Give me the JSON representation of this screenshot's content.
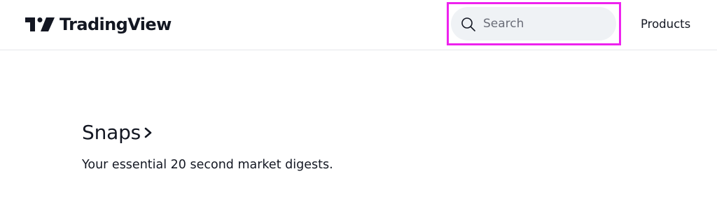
{
  "header": {
    "logo_text": "TradingView",
    "search": {
      "placeholder": "Search",
      "value": ""
    },
    "nav": {
      "products_label": "Products"
    }
  },
  "main": {
    "section_title": "Snaps",
    "section_description": "Your essential 20 second market digests."
  },
  "colors": {
    "text": "#131722",
    "search_background": "#eff2f5",
    "highlight_border": "#ee22ee",
    "divider": "#e6e7ea"
  },
  "icons": {
    "logo": "tradingview-logo-icon",
    "search": "search-icon",
    "section_arrow": "chevron-right-icon"
  }
}
